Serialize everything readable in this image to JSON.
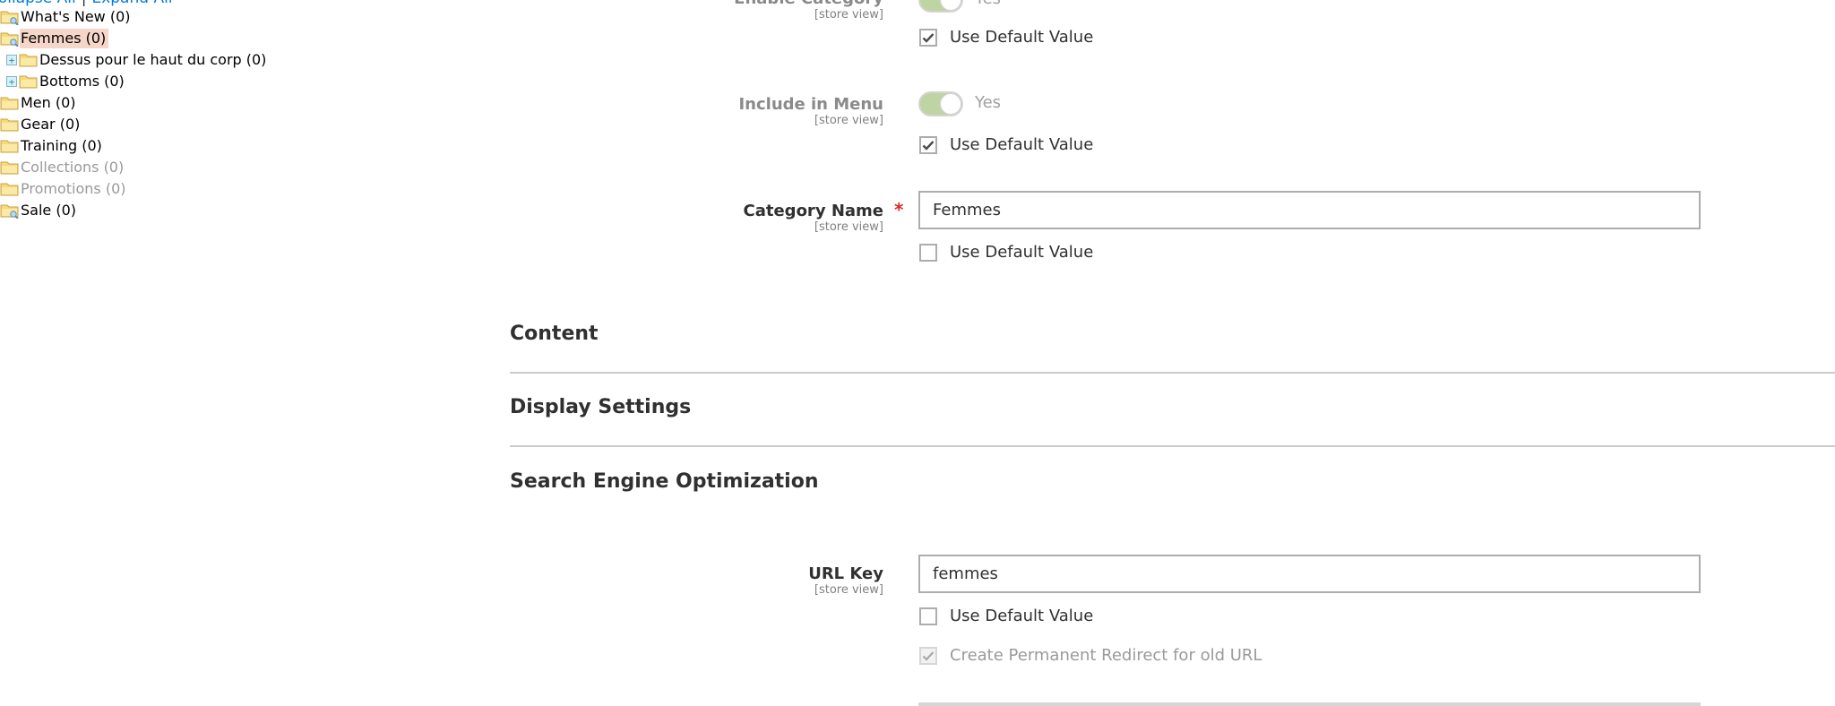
{
  "tree": {
    "collapse_all": "Collapse All",
    "expand_all": "Expand All",
    "separator": "|",
    "nodes": [
      {
        "label": "What's New (0)",
        "icon": "folder-search-icon",
        "disabled": false
      },
      {
        "label": "Femmes (0)",
        "icon": "folder-search-icon",
        "selected": true
      },
      {
        "label": "Dessus pour le haut du corp (0)",
        "icon": "folder-icon",
        "expandable": true
      },
      {
        "label": "Bottoms (0)",
        "icon": "folder-icon",
        "expandable": true
      },
      {
        "label": "Men (0)",
        "icon": "folder-icon"
      },
      {
        "label": "Gear (0)",
        "icon": "folder-icon"
      },
      {
        "label": "Training (0)",
        "icon": "folder-icon"
      },
      {
        "label": "Collections (0)",
        "icon": "folder-icon",
        "disabled": true
      },
      {
        "label": "Promotions (0)",
        "icon": "folder-icon",
        "disabled": true
      },
      {
        "label": "Sale (0)",
        "icon": "folder-search-icon"
      }
    ],
    "expander_symbol": "+"
  },
  "form": {
    "enable_category": {
      "label": "Enable Category",
      "scope": "[store view]",
      "value": "Yes",
      "use_default_label": "Use Default Value",
      "use_default_checked": true
    },
    "include_in_menu": {
      "label": "Include in Menu",
      "scope": "[store view]",
      "value": "Yes",
      "use_default_label": "Use Default Value",
      "use_default_checked": true
    },
    "category_name": {
      "label": "Category Name",
      "required_mark": "*",
      "scope": "[store view]",
      "value": "Femmes",
      "use_default_label": "Use Default Value",
      "use_default_checked": false
    },
    "sections": {
      "content": "Content",
      "display_settings": "Display Settings",
      "seo": "Search Engine Optimization"
    },
    "url_key": {
      "label": "URL Key",
      "scope": "[store view]",
      "value": "femmes",
      "use_default_label": "Use Default Value",
      "use_default_checked": false,
      "redirect_label": "Create Permanent Redirect for old URL",
      "redirect_checked": true,
      "redirect_disabled": true
    }
  },
  "colors": {
    "link": "#007bdb",
    "selected_bg": "#f5d6c8",
    "toggle_on": "#bfd4a3",
    "required": "#e22626"
  }
}
